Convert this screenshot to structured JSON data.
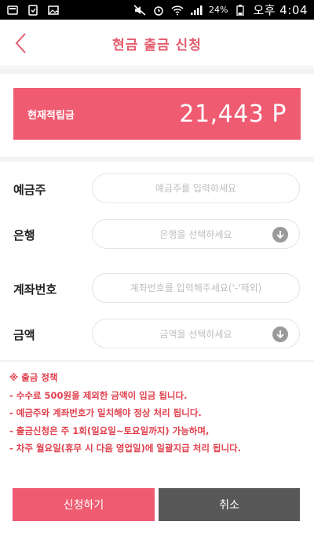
{
  "status_bar": {
    "battery_percent": "24%",
    "time": "오후 4:04"
  },
  "header": {
    "title": "현금 출금 신청"
  },
  "points": {
    "label": "현재적립금",
    "value": "21,443 P"
  },
  "form": {
    "depositor": {
      "label": "예금주",
      "placeholder": "예금주를 입력하세요"
    },
    "bank": {
      "label": "은행",
      "placeholder": "은행을 선택하세요"
    },
    "account": {
      "label": "계좌번호",
      "placeholder": "계좌번호를 입력해주세요('-'제외)"
    },
    "amount": {
      "label": "금액",
      "placeholder": "금액을 선택하세요"
    }
  },
  "policy": {
    "title": "※ 출금 정책",
    "items": [
      "- 수수료 500원을 제외한 금액이 입금 됩니다.",
      "- 예금주와 계좌번호가 일치해야 정상 처리 됩니다.",
      "- 출금신청은 주 1회(일요일~토요일까지) 가능하며,",
      "- 차주 월요일(휴무 시 다음 영업일)에 일괄지급 처리 됩니다."
    ]
  },
  "buttons": {
    "apply": "신청하기",
    "cancel": "취소"
  },
  "colors": {
    "accent": "#ef5c72",
    "title": "#e35b6e",
    "policy_text": "#e0404e",
    "cancel_button": "#585858"
  }
}
